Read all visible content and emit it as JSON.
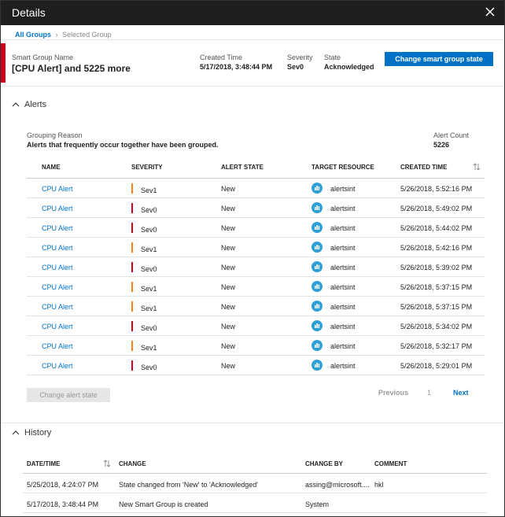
{
  "window": {
    "title": "Details"
  },
  "breadcrumb": {
    "root": "All Groups",
    "current": "Selected Group"
  },
  "summary": {
    "name_label": "Smart Group Name",
    "name_value": "[CPU Alert] and 5225 more",
    "created_label": "Created Time",
    "created_value": "5/17/2018, 3:48:44 PM",
    "severity_label": "Severity",
    "severity_value": "Sev0",
    "state_label": "State",
    "state_value": "Acknowledged",
    "change_state_button": "Change smart group state"
  },
  "alerts_section": {
    "title": "Alerts",
    "grouping_label": "Grouping Reason",
    "grouping_value": "Alerts that frequently occur together have been grouped.",
    "count_label": "Alert Count",
    "count_value": "5226",
    "columns": [
      "NAME",
      "SEVERITY",
      "ALERT STATE",
      "TARGET RESOURCE",
      "CREATED TIME"
    ],
    "rows": [
      {
        "name": "CPU Alert",
        "severity": "Sev1",
        "state": "New",
        "resource": "alertsint",
        "time": "5/26/2018, 5:52:16 PM"
      },
      {
        "name": "CPU Alert",
        "severity": "Sev0",
        "state": "New",
        "resource": "alertsint",
        "time": "5/26/2018, 5:49:02 PM"
      },
      {
        "name": "CPU Alert",
        "severity": "Sev0",
        "state": "New",
        "resource": "alertsint",
        "time": "5/26/2018, 5:44:02 PM"
      },
      {
        "name": "CPU Alert",
        "severity": "Sev1",
        "state": "New",
        "resource": "alertsint",
        "time": "5/26/2018, 5:42:16 PM"
      },
      {
        "name": "CPU Alert",
        "severity": "Sev0",
        "state": "New",
        "resource": "alertsint",
        "time": "5/26/2018, 5:39:02 PM"
      },
      {
        "name": "CPU Alert",
        "severity": "Sev1",
        "state": "New",
        "resource": "alertsint",
        "time": "5/26/2018, 5:37:15 PM"
      },
      {
        "name": "CPU Alert",
        "severity": "Sev1",
        "state": "New",
        "resource": "alertsint",
        "time": "5/26/2018, 5:37:15 PM"
      },
      {
        "name": "CPU Alert",
        "severity": "Sev0",
        "state": "New",
        "resource": "alertsint",
        "time": "5/26/2018, 5:34:02 PM"
      },
      {
        "name": "CPU Alert",
        "severity": "Sev1",
        "state": "New",
        "resource": "alertsint",
        "time": "5/26/2018, 5:32:17 PM"
      },
      {
        "name": "CPU Alert",
        "severity": "Sev0",
        "state": "New",
        "resource": "alertsint",
        "time": "5/26/2018, 5:29:01 PM"
      }
    ],
    "change_alert_state_button": "Change alert state",
    "pager": {
      "previous": "Previous",
      "page": "1",
      "next": "Next"
    }
  },
  "history_section": {
    "title": "History",
    "columns": [
      "DATE/TIME",
      "CHANGE",
      "CHANGE BY",
      "COMMENT"
    ],
    "rows": [
      {
        "datetime": "5/25/2018, 4:24:07 PM",
        "change": "State changed from 'New' to 'Acknowledged'",
        "by": "assing@microsoft....",
        "comment": "hkl"
      },
      {
        "datetime": "5/17/2018, 3:48:44 PM",
        "change": "New Smart Group is created",
        "by": "System",
        "comment": ""
      }
    ]
  },
  "colors": {
    "accent": "#0072c6",
    "sev0": "#d0021b",
    "sev1": "#f7811c",
    "titlebar": "#1f1f1f"
  },
  "icons": {
    "close": "close-icon",
    "collapse": "chevron-up-icon",
    "sort": "sort-icon",
    "resource": "monitor-resource-icon"
  }
}
